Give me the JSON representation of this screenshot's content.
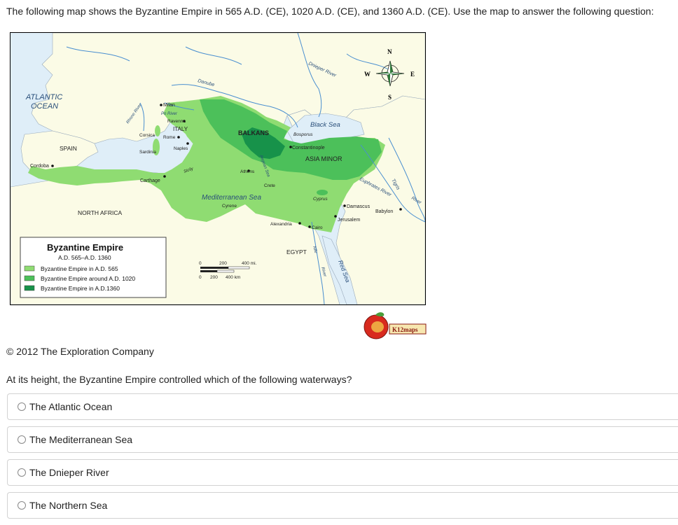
{
  "prompt": "The following map shows the Byzantine Empire in 565 A.D. (CE), 1020 A.D. (CE), and 1360 A.D. (CE). Use the map to answer the following question:",
  "map": {
    "labels": {
      "atlantic1": "ATLANTIC",
      "atlantic2": "OCEAN",
      "danube": "Danube",
      "dnieper": "Dnieper River",
      "rhone": "Rhone River",
      "milan": "Milan",
      "po": "Po River",
      "ravenna": "Ravenna",
      "italy": "ITALY",
      "corsica": "Corsica",
      "rome": "Rome",
      "balkans": "BALKANS",
      "black_sea": "Black Sea",
      "bosporus": "Bosporus",
      "constantinople": "Constantinople",
      "spain": "SPAIN",
      "sardinia": "Sardinia",
      "naples": "Naples",
      "asia_minor": "ASIA MINOR",
      "cordoba": "Cordoba",
      "carthage": "Carthage",
      "sicily": "Sicily",
      "athens": "Athens",
      "aegean": "Aegean Sea",
      "crete": "Crete",
      "euphrates": "Euphrates River",
      "tigris": "Tigris",
      "river": "River",
      "mediterranean": "Mediterranean Sea",
      "cyprus": "Cyprus",
      "damascus": "Damascus",
      "babylon": "Babylon",
      "cyrene": "Cyrene",
      "north_africa": "NORTH AFRICA",
      "jerusalem": "Jerusalem",
      "alexandria": "Alexandria",
      "cairo": "Cairo",
      "egypt": "EGYPT",
      "nile": "Nile",
      "nile_river": "River",
      "red_sea": "Red Sea",
      "scale_mi_0": "0",
      "scale_mi_200": "200",
      "scale_mi_400": "400 mi.",
      "scale_km_0": "0",
      "scale_km_200": "200",
      "scale_km_400": "400 km"
    },
    "compass": {
      "n": "N",
      "s": "S",
      "e": "E",
      "w": "W"
    },
    "legend": {
      "title": "Byzantine Empire",
      "subtitle": "A.D. 565–A.D. 1360",
      "items": [
        {
          "label": "Byzantine Empire in A.D. 565",
          "color": "#8fdc72"
        },
        {
          "label": "Byzantine Empire around A.D. 1020",
          "color": "#4cc05a"
        },
        {
          "label": "Byzantine Empire in A.D.1360",
          "color": "#17924a"
        }
      ]
    },
    "logo_text": "K12maps",
    "colors": {
      "water": "#dfeef8",
      "land": "#fbfbe6",
      "empire_565": "#8fdc72",
      "empire_1020": "#4cc05a",
      "empire_1360": "#17924a",
      "river": "#4a8fd0"
    }
  },
  "copyright": "© 2012 The Exploration Company",
  "question": "At its height, the Byzantine Empire controlled which of the following waterways?",
  "options": [
    {
      "label": "The Atlantic Ocean"
    },
    {
      "label": "The Mediterranean Sea"
    },
    {
      "label": "The Dnieper River"
    },
    {
      "label": "The Northern Sea"
    }
  ]
}
